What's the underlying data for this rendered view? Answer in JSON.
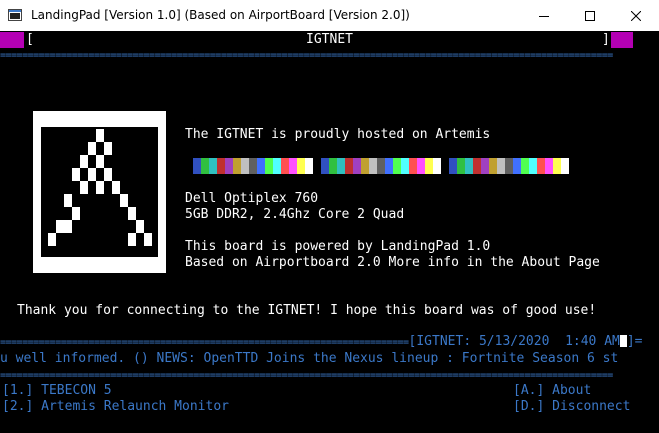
{
  "window": {
    "title": "LandingPad [Version 1.0] (Based on AirportBoard [Version 2.0])"
  },
  "header": {
    "left_bracket": "[",
    "right_bracket": "]",
    "board_name": "IGTNET"
  },
  "info": {
    "hosted_line": "The IGTNET is proudly hosted on Artemis",
    "hardware_model": "Dell Optiplex 760",
    "hardware_specs": "5GB DDR2, 2.4Ghz Core 2 Quad",
    "powered_by": "This board is powered by LandingPad 1.0",
    "based_on": "Based on Airportboard 2.0 More info in the About Page"
  },
  "footer_message": "Thank you for connecting to the IGTNET! I hope this board was of good use!",
  "status": {
    "prefix": "[IGTNET: 5/13/2020  1:40 AM",
    "suffix": "]="
  },
  "ticker": "u well informed. () NEWS: OpenTTD Joins the Nexus lineup : Fortnite Season 6 st",
  "menu": {
    "left": [
      "[1.] TEBECON 5",
      "[2.] Artemis Relaunch Monitor"
    ],
    "right": [
      "[A.] About",
      "[D.] Disconnect"
    ]
  },
  "colors": {
    "accent_blue": "#3b78c8",
    "header_magenta": "#b400b4"
  },
  "swatch_colors": [
    "#3050c0",
    "#30c040",
    "#30c0c0",
    "#c03030",
    "#a040c0",
    "#c0a030",
    "#c0c0c0",
    "#606060",
    "#4070ff",
    "#50ff50",
    "#50ffff",
    "#ff5050",
    "#ff50ff",
    "#ffff50",
    "#ffffff",
    "#000000",
    "#3050c0",
    "#30c040",
    "#30c0c0",
    "#c03030",
    "#a040c0",
    "#c0a030",
    "#c0c0c0",
    "#606060",
    "#4070ff",
    "#50ff50",
    "#50ffff",
    "#ff5050",
    "#ff50ff",
    "#ffff50",
    "#ffffff",
    "#000000",
    "#3050c0",
    "#30c040",
    "#30c0c0",
    "#c03030",
    "#a040c0",
    "#c0a030",
    "#c0c0c0",
    "#606060",
    "#4070ff",
    "#50ff50",
    "#50ffff",
    "#ff5050",
    "#ff50ff",
    "#ffff50",
    "#ffffff"
  ]
}
